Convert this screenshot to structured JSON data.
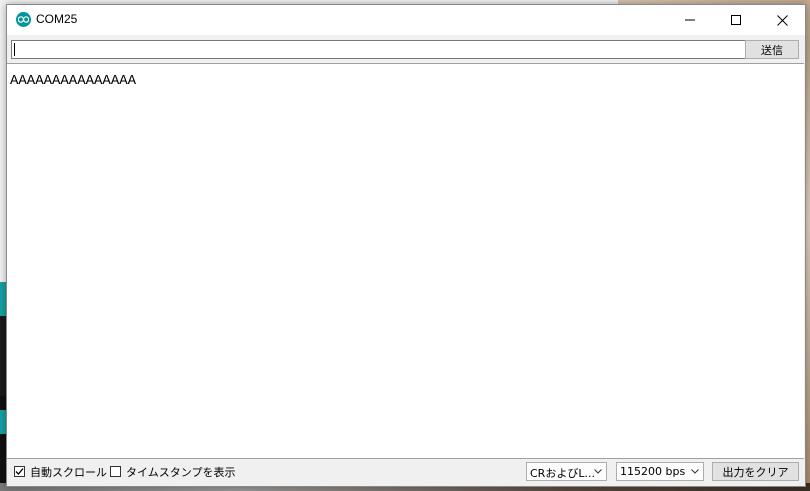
{
  "window": {
    "title": "COM25",
    "icon": "arduino-infinity-icon",
    "controls": [
      "minimize-icon",
      "maximize-icon",
      "close-icon"
    ]
  },
  "send": {
    "input_value": "",
    "button_label": "送信"
  },
  "output": {
    "lines": [
      "AAAAAAAAAAAAAAA"
    ]
  },
  "footer": {
    "autoscroll": {
      "label": "自動スクロール",
      "checked": true
    },
    "timestamp": {
      "label": "タイムスタンプを表示",
      "checked": false
    },
    "line_ending": {
      "value": "CRおよびL..."
    },
    "baud_rate": {
      "value": "115200 bps"
    },
    "clear_label": "出力をクリア"
  },
  "colors": {
    "accent": "#00979c"
  }
}
